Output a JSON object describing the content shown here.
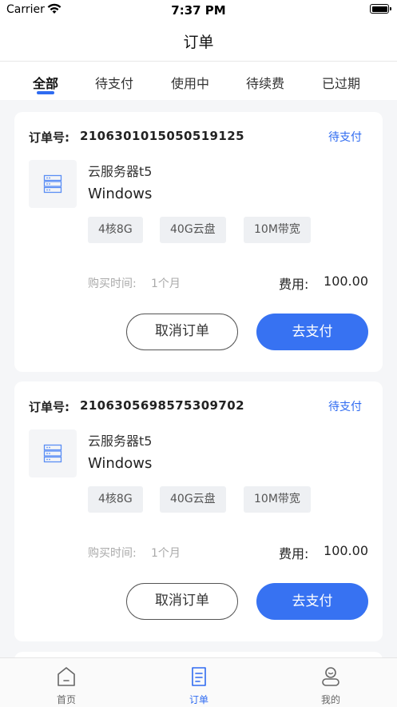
{
  "status_bar": {
    "carrier": "Carrier",
    "time": "7:37 PM"
  },
  "nav": {
    "title": "订单"
  },
  "tabs": [
    {
      "label": "全部",
      "active": true
    },
    {
      "label": "待支付",
      "active": false
    },
    {
      "label": "使用中",
      "active": false
    },
    {
      "label": "待续费",
      "active": false
    },
    {
      "label": "已过期",
      "active": false
    }
  ],
  "orders": [
    {
      "order_label": "订单号:",
      "order_no": "2106301015050519125",
      "status": "待支付",
      "product_name": "云服务器t5",
      "os": "Windows",
      "specs": [
        "4核8G",
        "40G云盘",
        "10M带宽"
      ],
      "buy_time_label": "购买时间:",
      "buy_time": "1个月",
      "fee_label": "费用:",
      "fee": "100.00",
      "cancel_label": "取消订单",
      "pay_label": "去支付"
    },
    {
      "order_label": "订单号:",
      "order_no": "2106305698575309702",
      "status": "待支付",
      "product_name": "云服务器t5",
      "os": "Windows",
      "specs": [
        "4核8G",
        "40G云盘",
        "10M带宽"
      ],
      "buy_time_label": "购买时间:",
      "buy_time": "1个月",
      "fee_label": "费用:",
      "fee": "100.00",
      "cancel_label": "取消订单",
      "pay_label": "去支付"
    }
  ],
  "tabbar": [
    {
      "label": "首页",
      "icon": "home-icon",
      "active": false
    },
    {
      "label": "订单",
      "icon": "order-icon",
      "active": true
    },
    {
      "label": "我的",
      "icon": "profile-icon",
      "active": false
    }
  ],
  "colors": {
    "accent": "#2f6bf1",
    "pay_button": "#3772f2",
    "background": "#f5f6f8"
  }
}
